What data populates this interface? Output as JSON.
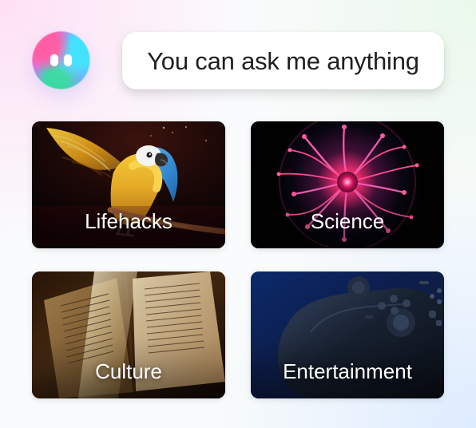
{
  "assistant": {
    "prompt": "You can ask me anything"
  },
  "topics": [
    {
      "label": "Lifehacks"
    },
    {
      "label": "Science"
    },
    {
      "label": "Culture"
    },
    {
      "label": "Entertainment"
    }
  ]
}
